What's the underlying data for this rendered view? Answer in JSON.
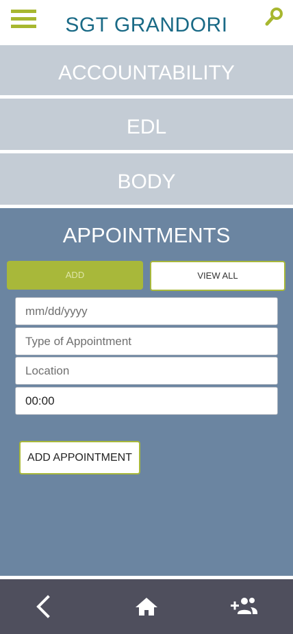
{
  "header": {
    "title": "SGT GRANDORI",
    "menu_icon": "hamburger-menu-icon",
    "search_icon": "search-icon"
  },
  "sections": {
    "accountability": "ACCOUNTABILITY",
    "edl": "EDL",
    "body": "BODY"
  },
  "appointments": {
    "title": "APPOINTMENTS",
    "tabs": {
      "add": "ADD",
      "view_all": "VIEW ALL"
    },
    "form": {
      "date_placeholder": "mm/dd/yyyy",
      "type_placeholder": "Type of Appointment",
      "location_placeholder": "Location",
      "time_value": "00:00"
    },
    "submit_label": "ADD APPOINTMENT"
  },
  "bottom_nav": {
    "back_icon": "chevron-left-icon",
    "home_icon": "home-icon",
    "add_person_icon": "add-person-icon"
  },
  "colors": {
    "accent": "#a8b83a",
    "title": "#1a6a86",
    "section_bar": "#c4ccd5",
    "panel": "#6b85a1",
    "nav": "#4f4f5d"
  }
}
